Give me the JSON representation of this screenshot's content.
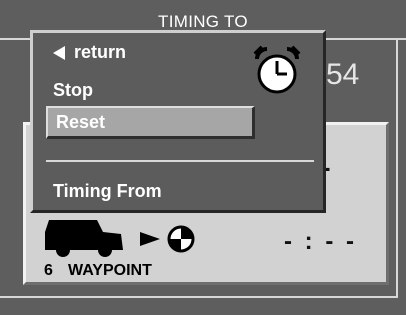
{
  "header": {
    "title": "TIMING TO"
  },
  "timer": {
    "partial_time": "54"
  },
  "panel": {
    "dashes_top": "- -",
    "dashes_bottom": "- : - -",
    "waypoint_number": "6",
    "waypoint_label": "WAYPOINT"
  },
  "menu": {
    "return_label": "return",
    "stop_label": "Stop",
    "reset_label": "Reset",
    "timing_from_label": "Timing From",
    "selected": "Reset",
    "icon": "stopwatch-icon"
  },
  "colors": {
    "background": "#5e5e5e",
    "panel": "#d2d2d2",
    "menu": "#5c5c5c",
    "highlight": "#a6a6a6",
    "text_light": "#ffffff",
    "text_dark": "#000000"
  }
}
